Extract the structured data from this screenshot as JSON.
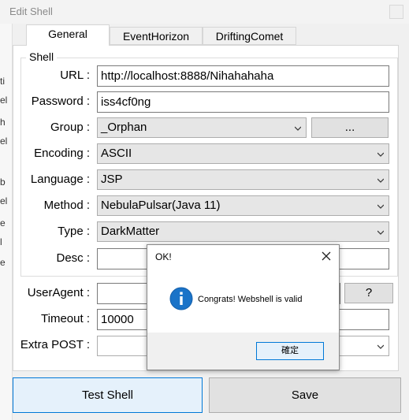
{
  "window": {
    "title": "Edit Shell"
  },
  "tabs": [
    {
      "label": "General"
    },
    {
      "label": "EventHorizon"
    },
    {
      "label": "DriftingComet"
    }
  ],
  "group": {
    "legend": "Shell"
  },
  "fields": {
    "url": {
      "label": "URL :",
      "value": "http://localhost:8888/Nihahahaha"
    },
    "password": {
      "label": "Password :",
      "value": "iss4cf0ng"
    },
    "group": {
      "label": "Group :",
      "value": "_Orphan",
      "button": "..."
    },
    "encoding": {
      "label": "Encoding :",
      "value": "ASCII"
    },
    "language": {
      "label": "Language :",
      "value": "JSP"
    },
    "method": {
      "label": "Method :",
      "value": "NebulaPulsar(Java 11)"
    },
    "type": {
      "label": "Type :",
      "value": "DarkMatter"
    },
    "desc": {
      "label": "Desc :",
      "value": ""
    },
    "useragent": {
      "label": "UserAgent :",
      "value": "",
      "button": "?"
    },
    "timeout": {
      "label": "Timeout :",
      "value": "10000"
    },
    "extra_post": {
      "label": "Extra POST :",
      "value": ""
    }
  },
  "buttons": {
    "test": "Test Shell",
    "save": "Save"
  },
  "dialog": {
    "title": "OK!",
    "message": "Congrats! Webshell is valid",
    "ok": "確定",
    "icon": "info-icon",
    "accent": "#1a73c8"
  },
  "left_strip_chars": [
    "ti",
    "el",
    "h",
    "el",
    "b",
    "el",
    "e",
    "l",
    "e"
  ],
  "colors": {
    "focus_border": "#0078d7",
    "focus_bg": "#e5f1fb"
  }
}
